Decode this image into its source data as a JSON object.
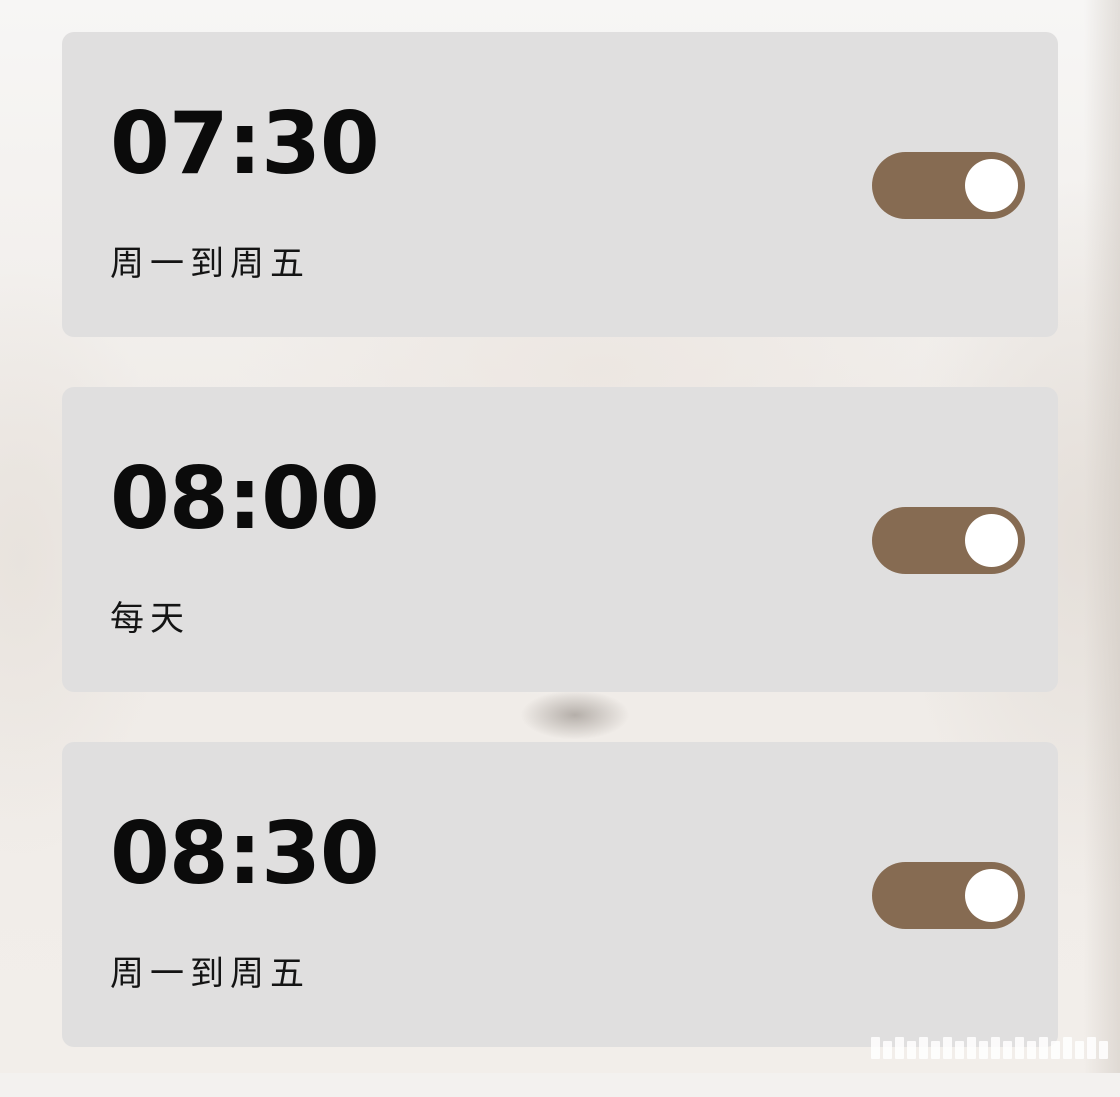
{
  "alarms": [
    {
      "time": "07:30",
      "repeat": "周一到周五",
      "enabled": true
    },
    {
      "time": "08:00",
      "repeat": "每天",
      "enabled": true
    },
    {
      "time": "08:30",
      "repeat": "周一到周五",
      "enabled": true
    }
  ],
  "colors": {
    "card_background": "#e0dfdf",
    "toggle_on": "#866b52",
    "toggle_knob": "#ffffff",
    "time_text": "#0b0b0b"
  }
}
